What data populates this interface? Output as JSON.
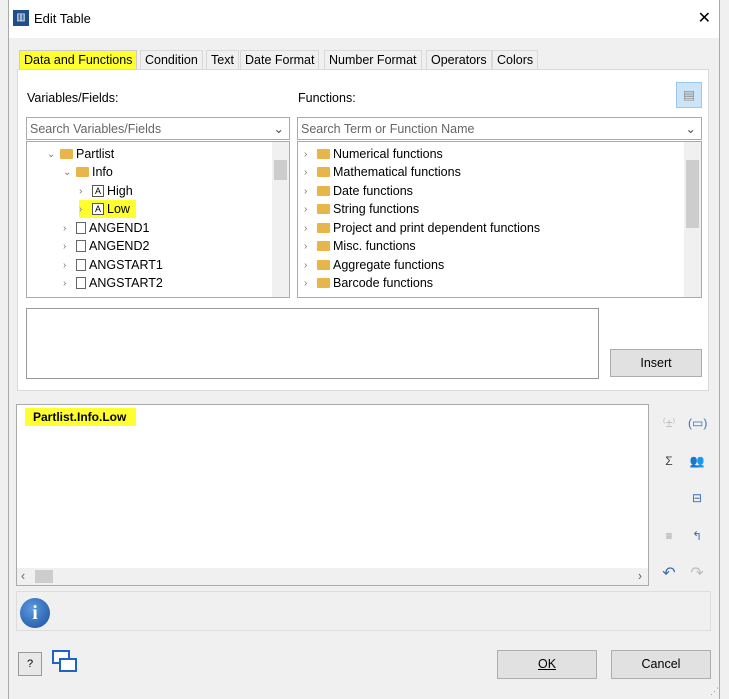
{
  "window": {
    "title": "Edit Table",
    "close": "✕"
  },
  "tabs": [
    "Data and Functions",
    "Condition",
    "Text",
    "Date Format",
    "Number Format",
    "Operators",
    "Colors"
  ],
  "variables": {
    "label": "Variables/Fields:",
    "placeholder": "Search Variables/Fields",
    "tree": [
      {
        "label": "Partlist",
        "icon": "folder",
        "expanded": true
      },
      {
        "label": "Info",
        "icon": "folder",
        "expanded": true
      },
      {
        "label": "High",
        "icon": "text-field"
      },
      {
        "label": "Low",
        "icon": "text-field",
        "selected": true
      },
      {
        "label": "ANGEND1",
        "icon": "document"
      },
      {
        "label": "ANGEND2",
        "icon": "document"
      },
      {
        "label": "ANGSTART1",
        "icon": "document"
      },
      {
        "label": "ANGSTART2",
        "icon": "document"
      }
    ]
  },
  "functions": {
    "label": "Functions:",
    "placeholder": "Search Term or Function Name",
    "tree": [
      "Numerical functions",
      "Mathematical functions",
      "Date functions",
      "String functions",
      "Project and print dependent functions",
      "Misc. functions",
      "Aggregate functions",
      "Barcode functions"
    ]
  },
  "insert_label": "Insert",
  "expression": "Partlist.Info.Low",
  "ok_label": "OK",
  "cancel_label": "Cancel",
  "highlight_color": "#ffff30"
}
